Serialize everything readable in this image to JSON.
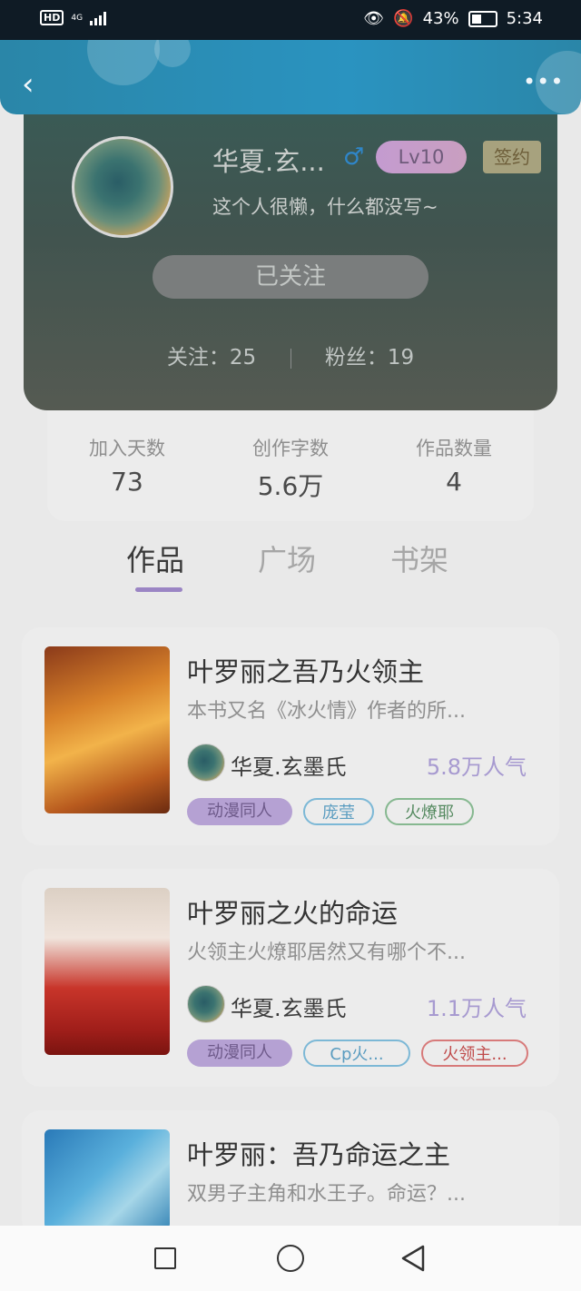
{
  "status_bar": {
    "left_indicators": [
      "HD",
      "4G"
    ],
    "battery": "43%",
    "time": "5:34",
    "icons": [
      "hd-icon",
      "signal-icon",
      "eye-icon",
      "bell-muted-icon",
      "battery-icon"
    ]
  },
  "header": {
    "back_icon": "chevron-left-icon",
    "more_icon": "more-dots-icon"
  },
  "profile": {
    "username": "华夏.玄...",
    "gender_icon": "male-icon",
    "level": "Lv10",
    "sign_badge": "签约",
    "bio": "这个人很懒，什么都没写~",
    "follow_button": "已关注",
    "following_label": "关注：",
    "following_count": "25",
    "fans_label": "粉丝：",
    "fans_count": "19"
  },
  "stats": [
    {
      "label": "加入天数",
      "value": "73"
    },
    {
      "label": "创作字数",
      "value": "5.6万"
    },
    {
      "label": "作品数量",
      "value": "4"
    }
  ],
  "tabs": [
    {
      "label": "作品",
      "active": true
    },
    {
      "label": "广场",
      "active": false
    },
    {
      "label": "书架",
      "active": false
    }
  ],
  "books": [
    {
      "title": "叶罗丽之吾乃火领主",
      "desc": "本书又名《冰火情》作者的所...",
      "author": "华夏.玄墨氏",
      "popularity": "5.8万人气",
      "tags": [
        "动漫同人",
        "庞莹",
        "火燎耶"
      ]
    },
    {
      "title": "叶罗丽之火的命运",
      "desc": "火领主火燎耶居然又有哪个不...",
      "author": "华夏.玄墨氏",
      "popularity": "1.1万人气",
      "tags": [
        "动漫同人",
        "Cp火...",
        "火领主..."
      ]
    },
    {
      "title": "叶罗丽：吾乃命运之主",
      "desc": "双男子主角和水王子。命运？..."
    }
  ],
  "nav_bar": {
    "icons": [
      "recent-apps-icon",
      "home-icon",
      "back-icon"
    ]
  }
}
